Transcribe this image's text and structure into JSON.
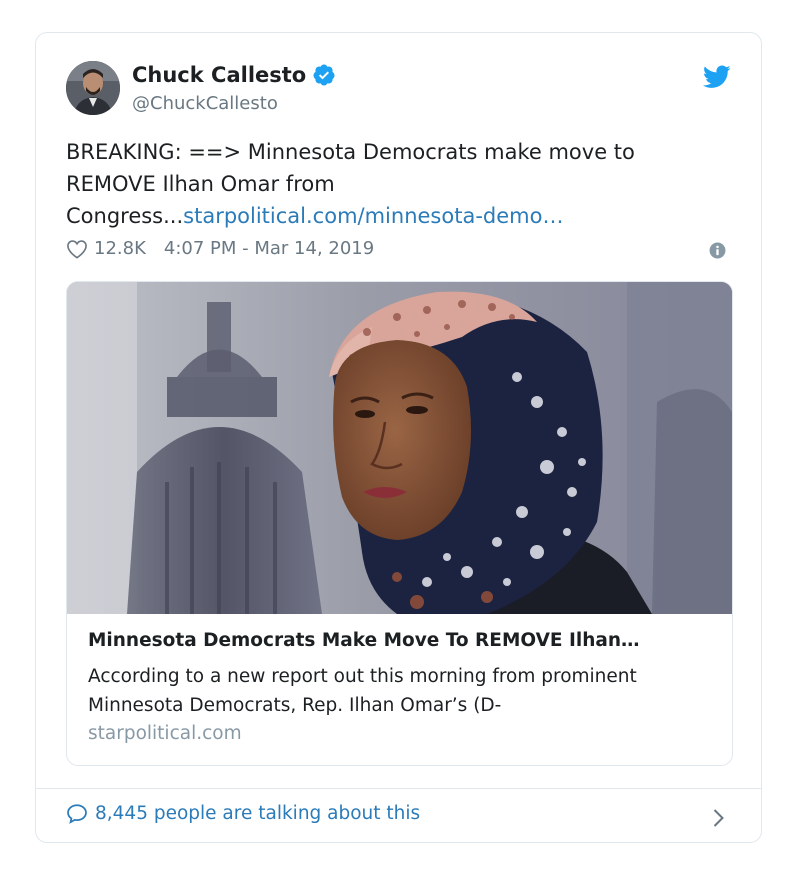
{
  "author": {
    "name": "Chuck Callesto",
    "handle": "@ChuckCallesto",
    "verified": true
  },
  "tweet": {
    "text": "BREAKING:  ==> Minnesota Democrats make move to REMOVE Ilhan Omar from Congress...",
    "link": "starpolitical.com/minnesota-demo…",
    "likes": "12.8K",
    "timestamp": "4:07 PM - Mar 14, 2019"
  },
  "card": {
    "title": "Minnesota Democrats Make Move To REMOVE Ilhan…",
    "description": "According to a new report out this morning from prominent Minnesota Democrats, Rep. Ilhan Omar’s (D-",
    "domain": "starpolitical.com"
  },
  "footer": {
    "conversation": "8,445 people are talking about this"
  },
  "icons": {
    "brand": "twitter-bird-icon",
    "verified": "verified-badge-icon",
    "like": "heart-icon",
    "info": "info-icon",
    "conversation": "speech-bubble-icon",
    "more": "chevron-right-icon"
  },
  "colors": {
    "accent": "#1da1f2",
    "link": "#2b7bb9",
    "secondary_text": "#697882",
    "border": "#e1e8ed"
  }
}
